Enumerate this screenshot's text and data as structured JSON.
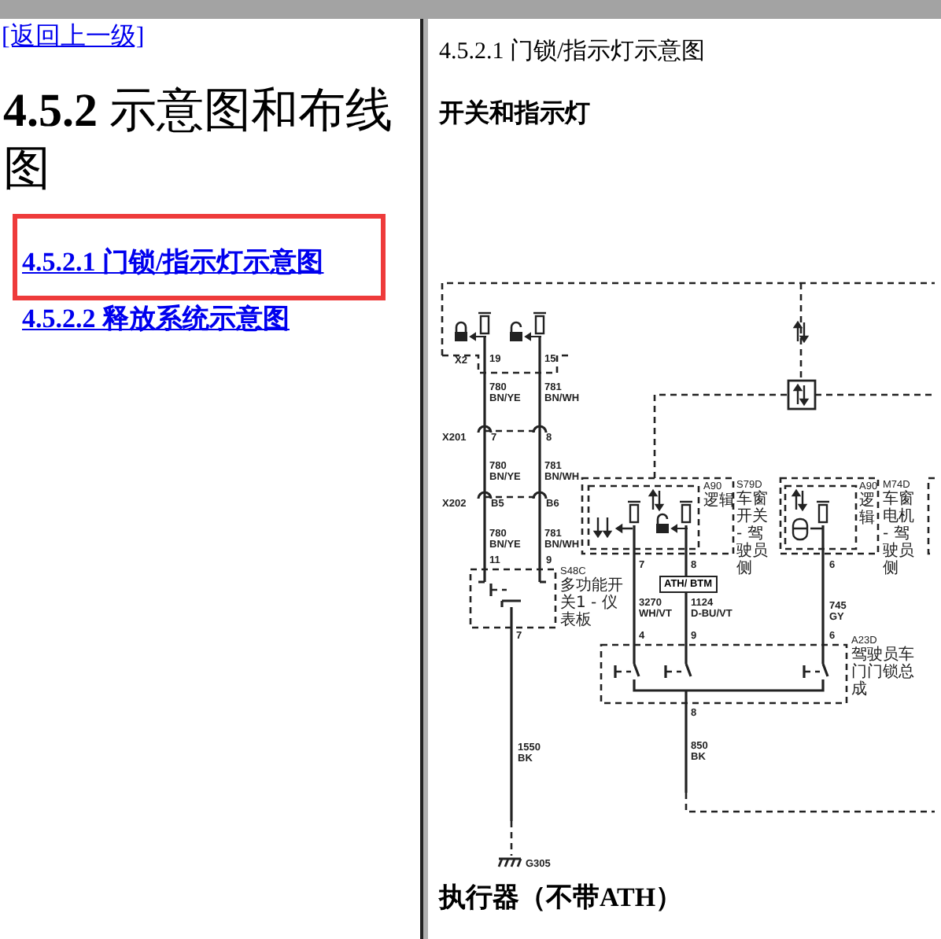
{
  "top_link": "[返回上一级]",
  "heading": "**4.5.2** 示意图和布线图",
  "nav_links": [
    {
      "label": "4.5.2.1 门锁/指示灯示意图",
      "highlighted": true
    },
    {
      "label": "4.5.2.2 释放系统示意图",
      "highlighted": false
    }
  ],
  "page_title": "4.5.2.1 门锁/指示灯示意图",
  "section_title": "开关和指示灯",
  "diagram": {
    "wire_labels": [
      "X2",
      "19",
      "15",
      "780",
      "BN/YE",
      "781",
      "BN/WH",
      "X201",
      "7",
      "8",
      "780",
      "BN/YE",
      "781",
      "BN/WH",
      "X202",
      "B5",
      "B6",
      "780",
      "BN/YE",
      "781",
      "BN/WH",
      "11",
      "9",
      "7",
      "1550",
      "BK",
      "G305",
      "7",
      "8",
      "6",
      "3270",
      "WH/VT",
      "1124",
      "D-BU/VT",
      "745",
      "GY",
      "4",
      "9",
      "6",
      "8",
      "850",
      "BK"
    ],
    "component_labels": [
      {
        "code": "S48C",
        "name": "多功能开关1 - 仪表板"
      },
      {
        "code": "A90",
        "name": "逻辑"
      },
      {
        "code": "S79D",
        "name": "车窗开关 - 驾驶员侧"
      },
      {
        "code": "A90",
        "name": "逻辑"
      },
      {
        "code": "M74D",
        "name": "车窗电机 - 驾驶员侧"
      },
      {
        "code": "A23D",
        "name": "驾驶员车门门锁总成"
      }
    ],
    "connector_box": "ATH/ BTM"
  },
  "next_section_title": "执行器（不带ATH）"
}
